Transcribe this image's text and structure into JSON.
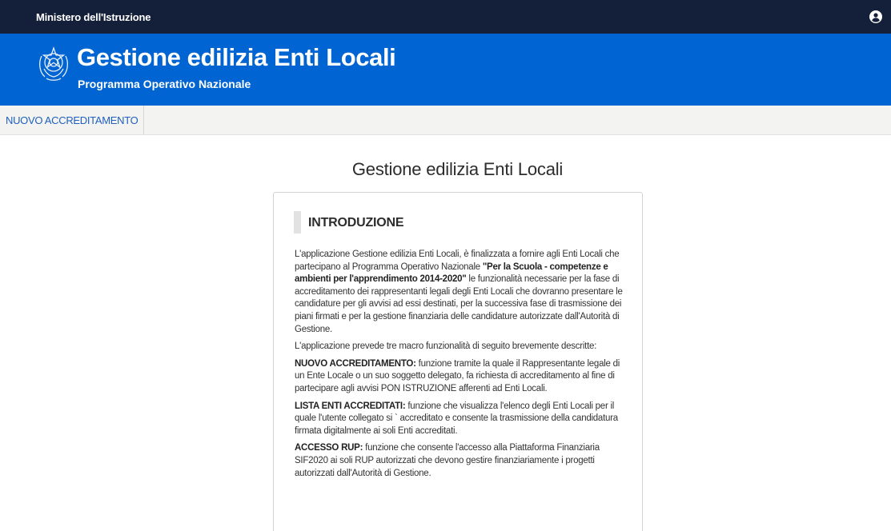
{
  "topbar": {
    "ministry": "Ministero dell'Istruzione",
    "user_icon": "user-circle-icon"
  },
  "header": {
    "emblem_icon": "italian-republic-emblem",
    "title": "Gestione edilizia Enti Locali",
    "subtitle": "Programma Operativo Nazionale",
    "background": "#0064d2"
  },
  "nav": {
    "items": [
      {
        "label": "NUOVO ACCREDITAMENTO"
      }
    ]
  },
  "page": {
    "title": "Gestione edilizia Enti Locali"
  },
  "intro": {
    "heading": "INTRODUZIONE",
    "p1_a": "L'applicazione Gestione edilizia Enti Locali, è finalizzata a fornire agli Enti Locali che partecipano al Programma Operativo Nazionale ",
    "p1_bold": "\"Per la Scuola - competenze e ambienti per l'apprendimento 2014-2020\"",
    "p1_b": " le funzionalità necessarie per la fase di accreditamento dei rappresentanti legali degli Enti Locali che dovranno presentare le candidature per gli avvisi ad essi destinati, per la successiva fase di trasmissione dei piani firmati e per la gestione finanziaria delle candidature autorizzate dall'Autorità di Gestione.",
    "p2": "L'applicazione prevede tre macro funzionalità di seguito brevemente descritte:",
    "f1_label": "NUOVO ACCREDITAMENTO:",
    "f1_text": " funzione tramite la quale il Rappresentante legale di un Ente Locale o un suo soggetto delegato, fa richiesta di accreditamento al fine di partecipare agli avvisi PON ISTRUZIONE afferenti ad Enti Locali.",
    "f2_label": "LISTA ENTI ACCREDITATI:",
    "f2_text": " funzione che visualizza l'elenco degli Enti Locali per il quale l'utente collegato si ` accreditato e consente la trasmissione della candidatura firmata digitalmente ai soli Enti accreditati.",
    "f3_label": "ACCESSO RUP:",
    "f3_text": " funzione che consente l'accesso alla Piattaforma Finanziaria SIF2020 ai soli RUP autorizzati che devono gestire finanziariamente i progetti autorizzati dall'Autorità di Gestione."
  }
}
